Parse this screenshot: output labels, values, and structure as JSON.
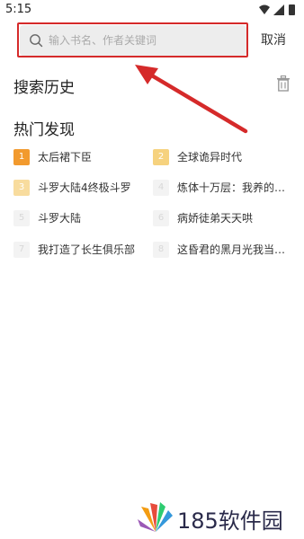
{
  "status_bar": {
    "time": "5:15"
  },
  "search": {
    "placeholder": "输入书名、作者关键词",
    "value": "",
    "cancel_label": "取消"
  },
  "history": {
    "title": "搜索历史"
  },
  "hot": {
    "title": "热门发现",
    "items": [
      {
        "rank": "1",
        "label": "太后裙下臣",
        "badge_color": "#f29a2e"
      },
      {
        "rank": "2",
        "label": "全球诡异时代",
        "badge_color": "#f6d27e"
      },
      {
        "rank": "3",
        "label": "斗罗大陆4终极斗罗",
        "badge_color": "#f8dc9e"
      },
      {
        "rank": "4",
        "label": "炼体十万层：我养的…",
        "badge_color": "#f3f3f3"
      },
      {
        "rank": "5",
        "label": "斗罗大陆",
        "badge_color": "#f3f3f3"
      },
      {
        "rank": "6",
        "label": "病娇徒弟天天哄",
        "badge_color": "#f3f3f3"
      },
      {
        "rank": "7",
        "label": "我打造了长生俱乐部",
        "badge_color": "#f3f3f3"
      },
      {
        "rank": "8",
        "label": "这昏君的黑月光我当…",
        "badge_color": "#f3f3f3"
      }
    ]
  },
  "watermark": {
    "text": "185软件园"
  },
  "colors": {
    "annotation": "#d52a2a",
    "accent": "#f29a2e"
  }
}
